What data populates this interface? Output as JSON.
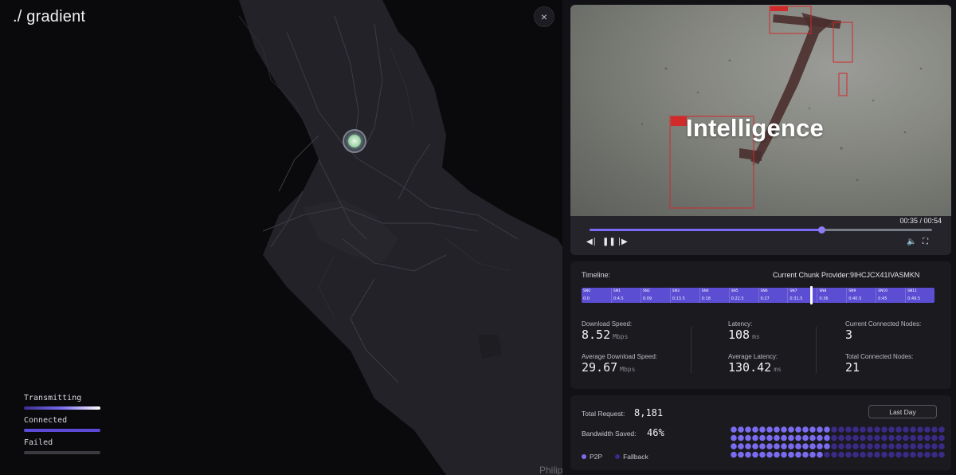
{
  "app": {
    "logo": "./ gradient",
    "close_icon": "×",
    "map_label": "Philip"
  },
  "legend": [
    {
      "label": "Transmitting",
      "color": "#7a6cf0"
    },
    {
      "label": "Connected",
      "color": "#5a4ad6"
    },
    {
      "label": "Failed",
      "color": "#3a3a40"
    }
  ],
  "video": {
    "overlay_text": "Intelligence",
    "time": "00:35 / 00:54",
    "progress": 0.677
  },
  "timeline": {
    "title": "Timeline:",
    "provider_label": "Current Chunk Provider:",
    "provider_id": "9IHCJCX41IVASMKN",
    "current_position": 0.68,
    "segments": [
      {
        "id": "SN0",
        "time": "0:0"
      },
      {
        "id": "SN1",
        "time": "0:4.5"
      },
      {
        "id": "SN2",
        "time": "0:09"
      },
      {
        "id": "SN3",
        "time": "0:13.5"
      },
      {
        "id": "SN4",
        "time": "0:18"
      },
      {
        "id": "SN5",
        "time": "0:22.5"
      },
      {
        "id": "SN6",
        "time": "0:27"
      },
      {
        "id": "SN7",
        "time": "0:31.5"
      },
      {
        "id": "SN8",
        "time": "0:36"
      },
      {
        "id": "SN9",
        "time": "0:40.5"
      },
      {
        "id": "SN10",
        "time": "0:45"
      },
      {
        "id": "SN11",
        "time": "0:49.5"
      }
    ]
  },
  "stats": {
    "download_speed": {
      "label": "Download Speed:",
      "value": "8.52",
      "unit": "Mbps"
    },
    "latency": {
      "label": "Latency:",
      "value": "108",
      "unit": "ms"
    },
    "current_nodes": {
      "label": "Current Connected Nodes:",
      "value": "3"
    },
    "avg_download_speed": {
      "label": "Average Download Speed:",
      "value": "29.67",
      "unit": "Mbps"
    },
    "avg_latency": {
      "label": "Average Latency:",
      "value": "130.42",
      "unit": "ms"
    },
    "total_nodes": {
      "label": "Total Connected Nodes:",
      "value": "21"
    }
  },
  "summary": {
    "total_request_label": "Total Request:",
    "total_request_value": "8,181",
    "bandwidth_label": "Bandwidth Saved:",
    "bandwidth_value": "46%",
    "bandwidth_fraction": 0.46,
    "range_button": "Last Day",
    "p2p_label": "P2P",
    "fallback_label": "Fallback",
    "p2p_color": "#7a6cf0",
    "fallback_color": "#3b2a86"
  }
}
